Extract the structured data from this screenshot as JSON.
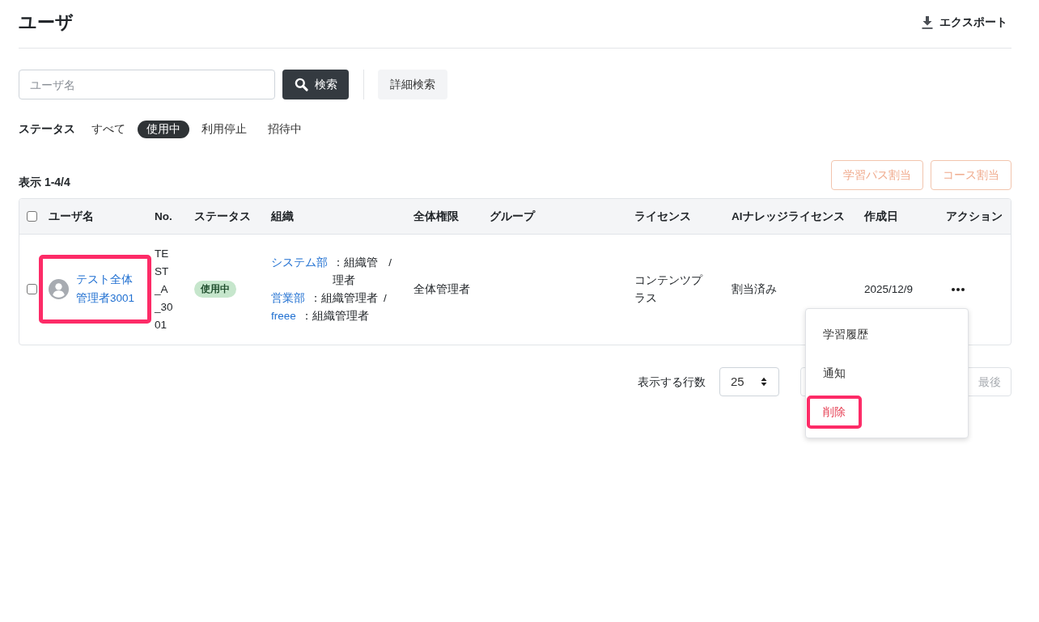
{
  "page": {
    "title": "ユーザ",
    "export_button": "エクスポート"
  },
  "search": {
    "placeholder": "ユーザ名",
    "search_button": "検索",
    "advanced_button": "詳細検索"
  },
  "status_filter": {
    "label": "ステータス",
    "options": [
      {
        "label": "すべて",
        "selected": false
      },
      {
        "label": "使用中",
        "selected": true
      },
      {
        "label": "利用停止",
        "selected": false
      },
      {
        "label": "招待中",
        "selected": false
      }
    ]
  },
  "summary": "表示 1-4/4",
  "bulk_actions": [
    {
      "label": "学習パス割当",
      "disabled": true
    },
    {
      "label": "コース割当",
      "disabled": true
    }
  ],
  "table": {
    "select_all_checked": false,
    "columns": [
      "ユーザ名",
      "No.",
      "ステータス",
      "組織",
      "全体権限",
      "グループ",
      "ライセンス",
      "AIナレッジライセンス",
      "作成日",
      "アクション"
    ],
    "rows": [
      {
        "checked": false,
        "highlighted": true,
        "name": "テスト全体管理者3001",
        "number": "TEST_A_3001",
        "status": {
          "label": "使用中",
          "kind": "active"
        },
        "organizations": [
          {
            "name": "システム部",
            "role": "：組織管理者",
            "separator": "/"
          },
          {
            "name": "営業部",
            "role": "：組織管理者",
            "separator": "/"
          },
          {
            "name": "freee",
            "role": "：組織管理者"
          }
        ],
        "permission": "全体管理者",
        "license": "コンテンツプラス",
        "ai_license": "割当済み",
        "created": "2025/12/9"
      }
    ]
  },
  "action_menu": {
    "items": [
      {
        "label": "学習履歴",
        "kind": "normal",
        "highlighted": false
      },
      {
        "label": "通知",
        "kind": "normal",
        "highlighted": false
      },
      {
        "label": "削除",
        "kind": "danger",
        "highlighted": true
      }
    ]
  },
  "pagination": {
    "rows_label": "表示する行数",
    "rows_per_page": "25",
    "buttons": [
      {
        "label": "最後",
        "disabled": true
      }
    ]
  }
}
